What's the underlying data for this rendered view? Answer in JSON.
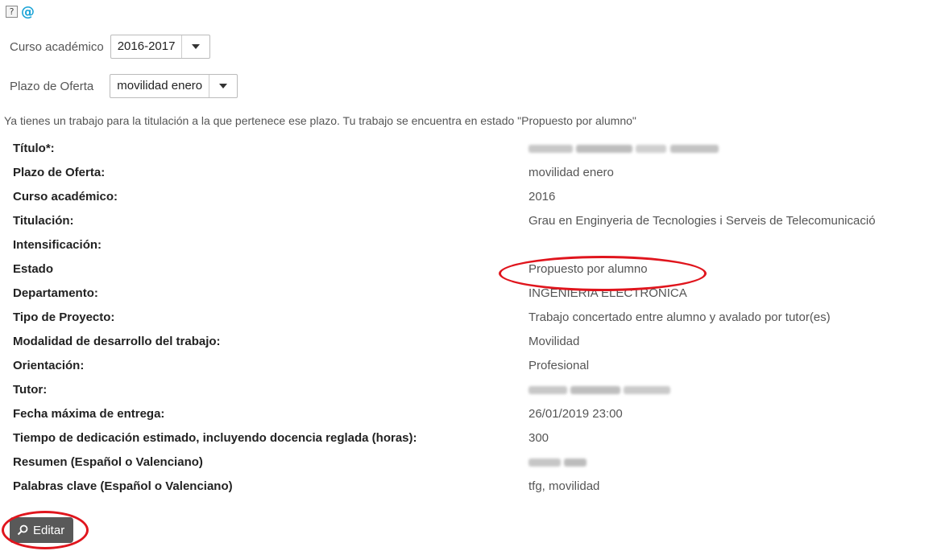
{
  "top_icons": {
    "help": "?",
    "help_icon": "help-icon",
    "email_icon": "at-sign-icon",
    "email": "@"
  },
  "filters": {
    "academic_year": {
      "label": "Curso académico",
      "value": "2016-2017"
    },
    "offer_period": {
      "label": "Plazo de Oferta",
      "value": "movilidad enero"
    }
  },
  "message": "Ya tienes un trabajo para la titulación a la que pertenece ese plazo. Tu trabajo se encuentra en estado \"Propuesto por alumno\"",
  "fields": [
    {
      "label": "Título*:",
      "value": ""
    },
    {
      "label": "Plazo de Oferta:",
      "value": "movilidad enero"
    },
    {
      "label": "Curso académico:",
      "value": "2016"
    },
    {
      "label": "Titulación:",
      "value": "Grau en Enginyeria de Tecnologies i Serveis de Telecomunicació"
    },
    {
      "label": "Intensificación:",
      "value": ""
    },
    {
      "label": "Estado",
      "value": "Propuesto por alumno"
    },
    {
      "label": "Departamento:",
      "value": "INGENIERIA ELECTRONICA"
    },
    {
      "label": "Tipo de Proyecto:",
      "value": "Trabajo concertado entre alumno y avalado por tutor(es)"
    },
    {
      "label": "Modalidad de desarrollo del trabajo:",
      "value": "Movilidad"
    },
    {
      "label": "Orientación:",
      "value": "Profesional"
    },
    {
      "label": "Tutor:",
      "value": ""
    },
    {
      "label": "Fecha máxima de entrega:",
      "value": "26/01/2019 23:00"
    },
    {
      "label": "Tiempo de dedicación estimado, incluyendo docencia reglada (horas):",
      "value": "300"
    },
    {
      "label": "Resumen (Español o Valenciano)",
      "value": ""
    },
    {
      "label": "Palabras clave (Español o Valenciano)",
      "value": "tfg, movilidad"
    }
  ],
  "actions": {
    "edit_label": "Editar",
    "edit_icon": "search-icon"
  },
  "colors": {
    "highlight": "#e0151d",
    "button_bg": "#595959",
    "email_icon": "#1aa3d6"
  }
}
